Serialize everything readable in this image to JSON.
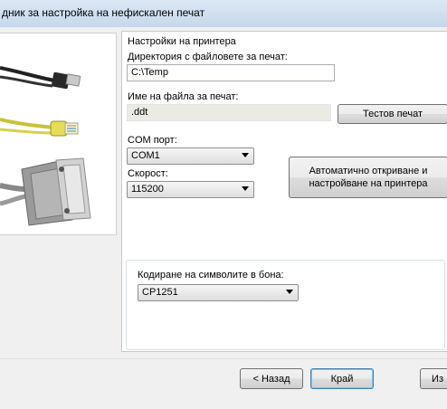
{
  "window": {
    "title": "дник за настройка на нефискален печат"
  },
  "printer_settings": {
    "section_label": "Настройки на принтера",
    "directory_label": "Директория с файловете за печат:",
    "directory_value": "C:\\Temp",
    "filename_label": "Име на файла за печат:",
    "filename_value": ".ddt",
    "test_print_button": "Тестов печат",
    "com_port_label": "COM порт:",
    "com_port_value": "COM1",
    "speed_label": "Скорост:",
    "speed_value": "115200",
    "auto_detect_button": "Автоматично откриване и настройване на принтера",
    "encoding_label": "Кодиране на символите в бона:",
    "encoding_value": "CP1251"
  },
  "footer": {
    "back_button": "< Назад",
    "finish_button": "Край",
    "cancel_button": "Из"
  },
  "images": {
    "cables": "usb-ethernet-parallel-cables-icon"
  }
}
